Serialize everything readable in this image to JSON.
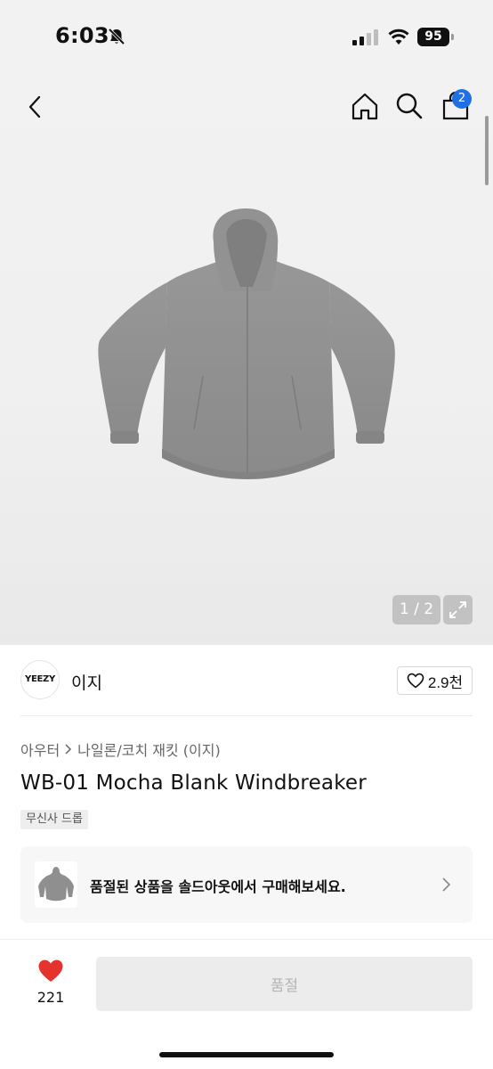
{
  "status_bar": {
    "time": "6:03",
    "battery": "95"
  },
  "nav": {
    "cart_count": "2"
  },
  "gallery": {
    "counter": "1 / 2"
  },
  "brand": {
    "logo_text": "YEEZY",
    "name": "이지",
    "likes": "2.9천"
  },
  "breadcrumb": {
    "category": "아우터",
    "subcategory": "나일론/코치 재킷 (이지)"
  },
  "product": {
    "title": "WB-01 Mocha Blank Windbreaker",
    "tag": "무신사 드롭"
  },
  "soldout_banner": {
    "text": "품절된 상품을 솔드아웃에서 구매해보세요."
  },
  "bottom_bar": {
    "like_count": "221",
    "buy_label": "품절"
  },
  "colors": {
    "accent": "#1f6fe5",
    "heart": "#e5322d",
    "jacket": "#8d8d8d"
  }
}
